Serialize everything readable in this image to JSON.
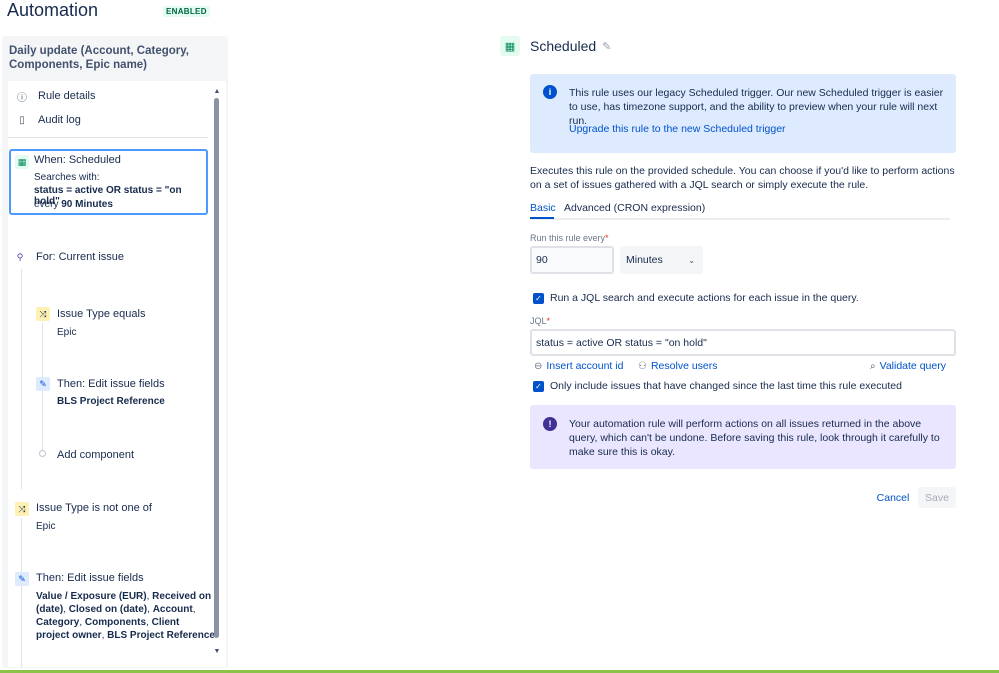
{
  "header": {
    "title": "Automation",
    "status_badge": "ENABLED"
  },
  "left": {
    "rule_name": "Daily update (Account, Category, Components, Epic name)",
    "nav": [
      {
        "label": "Rule details",
        "icon": "info-icon"
      },
      {
        "label": "Audit log",
        "icon": "document-icon"
      }
    ],
    "trigger": {
      "title": "When: Scheduled",
      "searches_with": "Searches with:",
      "jql_line": "status = active OR status = \"on hold\"",
      "every_prefix": "every",
      "every_value": "90 Minutes"
    },
    "branch": {
      "title": "For: Current issue"
    },
    "condition1": {
      "title": "Issue Type equals",
      "value": "Epic"
    },
    "action1": {
      "title": "Then: Edit issue fields",
      "value": "BLS Project Reference"
    },
    "add_component": "Add component",
    "condition2": {
      "title": "Issue Type is not one of",
      "value": "Epic"
    },
    "action2": {
      "title": "Then: Edit issue fields",
      "line1_a": "Value / Exposure (EUR)",
      "line1_b": ", ",
      "line1_c": "Received on",
      "line2_a": "(date)",
      "line2_b": ", ",
      "line2_c": "Closed on (date)",
      "line2_d": ", ",
      "line2_e": "Account",
      "line2_f": ",",
      "line3_a": "Category",
      "line3_b": ", ",
      "line3_c": "Components",
      "line3_d": ", ",
      "line3_e": "Client",
      "line4_a": "project owner",
      "line4_b": ", ",
      "line4_c": "BLS Project Reference"
    }
  },
  "right": {
    "title": "Scheduled",
    "info": {
      "message": "This rule uses our legacy Scheduled trigger. Our new Scheduled trigger is easier to use, has timezone support, and the ability to preview when your rule will next run.",
      "link": "Upgrade this rule to the new Scheduled trigger"
    },
    "description": "Executes this rule on the provided schedule. You can choose if you'd like to perform actions on a set of issues gathered with a JQL search or simply execute the rule.",
    "tabs": [
      {
        "label": "Basic",
        "active": true
      },
      {
        "label": "Advanced (CRON expression)",
        "active": false
      }
    ],
    "run_every_label": "Run this rule every",
    "required_mark": "*",
    "run_every_value": "90",
    "unit_value": "Minutes",
    "run_jql_label": "Run a JQL search and execute actions for each issue in the query.",
    "jql_label": "JQL",
    "jql_value": "status = active OR status = \"on hold\"",
    "insert_account": "Insert account id",
    "resolve_users": "Resolve users",
    "validate_query": "Validate query",
    "only_changed_label": "Only include issues that have changed since the last time this rule executed",
    "warning": "Your automation rule will perform actions on all issues returned in the above query, which can't be undone. Before saving this rule, look through it carefully to make sure this is okay.",
    "cancel": "Cancel",
    "save": "Save"
  }
}
